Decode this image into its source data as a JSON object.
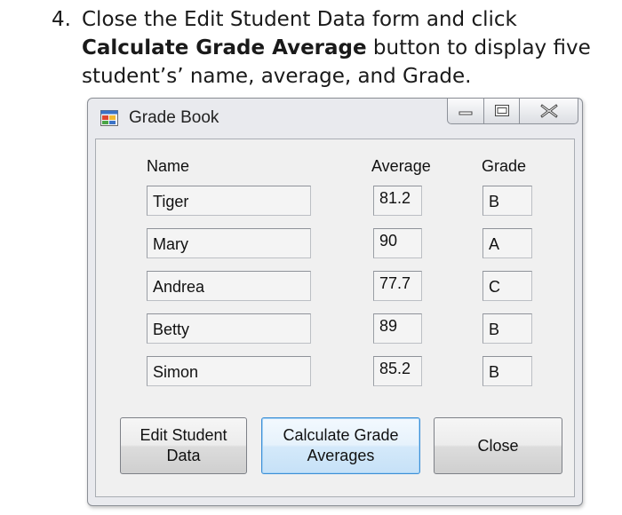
{
  "instruction": {
    "number": "4.",
    "text_before": "Close the Edit Student Data form and click ",
    "bold": "Calculate Grade Average",
    "text_after": " button to display five student’s’ name, average, and Grade."
  },
  "window": {
    "title": "Grade Book",
    "icon": "form-app-icon"
  },
  "columns": {
    "name": "Name",
    "average": "Average",
    "grade": "Grade"
  },
  "students": [
    {
      "name": "Tiger",
      "average": "81.2",
      "grade": "B"
    },
    {
      "name": "Mary",
      "average": "90",
      "grade": "A"
    },
    {
      "name": "Andrea",
      "average": "77.7",
      "grade": "C"
    },
    {
      "name": "Betty",
      "average": "89",
      "grade": "B"
    },
    {
      "name": "Simon",
      "average": "85.2",
      "grade": "B"
    }
  ],
  "buttons": {
    "edit": "Edit Student\nData",
    "calculate": "Calculate Grade\nAverages",
    "close": "Close"
  }
}
